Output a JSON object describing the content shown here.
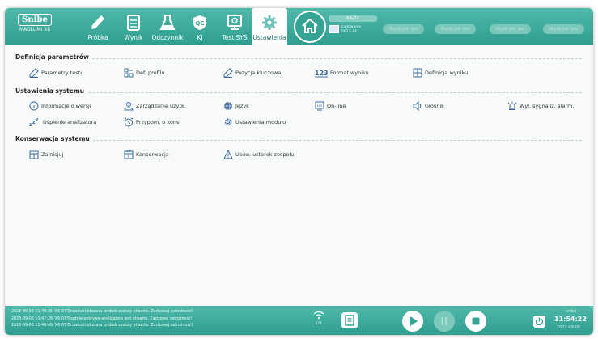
{
  "logo": {
    "brand": "Snibe",
    "model": "MAGLUMI X8"
  },
  "nav": {
    "tabs": [
      {
        "name": "tab-probka",
        "label": "Próbka",
        "icon": "pencil-icon"
      },
      {
        "name": "tab-wynik",
        "label": "Wynik",
        "icon": "results-list-icon"
      },
      {
        "name": "tab-odczynnik",
        "label": "Odczynnik",
        "icon": "flask-icon"
      },
      {
        "name": "tab-kj",
        "label": "KJ",
        "icon": "qc-shield-icon"
      },
      {
        "name": "tab-test-sys",
        "label": "Test SYS",
        "icon": "system-test-icon"
      },
      {
        "name": "tab-ustawienia",
        "label": "Ustawienia",
        "icon": "gear-icon",
        "active": true
      }
    ]
  },
  "sample": {
    "position": "X6-01",
    "status": "Ładowanie",
    "id": "0023-14"
  },
  "placeholders": [
    "Wyjdź poł. pos",
    "Wyjdź poł. pos",
    "Wyjdź poł. pos",
    "Wyjdź poł. pos"
  ],
  "sections": {
    "definicja": {
      "title": "Definicja parametrów",
      "items": [
        "Parametry testu",
        "Def. profilu",
        "Pozycja kluczowa",
        "Format wyniku",
        "Definicja wyniku"
      ]
    },
    "ustawienia": {
      "title": "Ustawienia systemu",
      "items": [
        "Informacje o wersji",
        "Zarządzanie użytk.",
        "Język",
        "On-line",
        "Głośnik",
        "Wył. sygnaliz. alarm.",
        "Uśpienie analizatora",
        "Przypom. o kons.",
        "Ustawienia modułu"
      ]
    },
    "konserwacja": {
      "title": "Konserwacja systemu",
      "items": [
        "Zainicjuj",
        "Konserwacja",
        "Usuw. usterek zespołu"
      ]
    }
  },
  "log": [
    "2023-09-06 11:49:35  'X6-07'Drzwiczki obszaru próbek zostały otwarte. Zachowaj ostrożność!",
    "2023-09-06 11:47:28  'X6-07'Pozdnia pokrywa analizatora jest otwarta. Zachowaj ostrożność!",
    "2023-09-06 11:46:40  'X6-07'Drzwiczki obszaru próbek zostały otwarte. Zachowaj ostrożność!"
  ],
  "status": {
    "lis": "LIS",
    "user": "snibe",
    "time": "11:54:22",
    "date": "2023-09-06"
  },
  "colors": {
    "primary": "#3aa999",
    "accent": "#2f8f82",
    "background": "#f8f9f9"
  }
}
